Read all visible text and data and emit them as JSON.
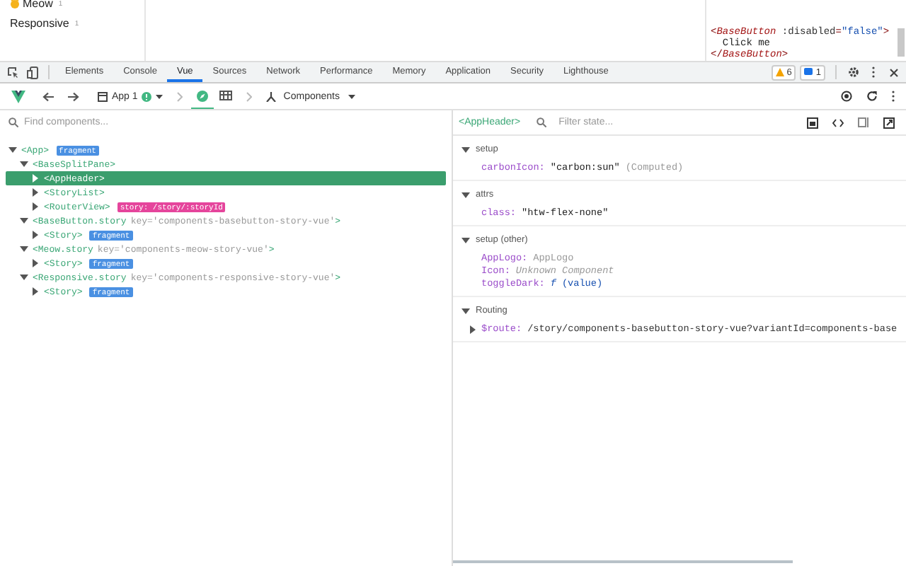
{
  "preview": {
    "stories": [
      {
        "label": "Meow",
        "count": "1",
        "emoji": true
      },
      {
        "label": "Responsive",
        "count": "1",
        "emoji": false
      }
    ],
    "code_lines": [
      [
        {
          "kind": "punct",
          "text": "<"
        },
        {
          "kind": "tag",
          "text": "BaseButton"
        },
        {
          "kind": "attr",
          "text": " :disabled"
        },
        {
          "kind": "punct",
          "text": "="
        },
        {
          "kind": "string",
          "text": "\"false\""
        },
        {
          "kind": "punct",
          "text": ">"
        }
      ],
      [
        {
          "kind": "text",
          "text": "  Click me"
        }
      ],
      [
        {
          "kind": "punct",
          "text": "</"
        },
        {
          "kind": "tag",
          "text": "BaseButton"
        },
        {
          "kind": "punct",
          "text": ">"
        }
      ]
    ]
  },
  "devtools_tabs": [
    {
      "label": "Elements",
      "selected": false
    },
    {
      "label": "Console",
      "selected": false
    },
    {
      "label": "Vue",
      "selected": true
    },
    {
      "label": "Sources",
      "selected": false
    },
    {
      "label": "Network",
      "selected": false
    },
    {
      "label": "Performance",
      "selected": false
    },
    {
      "label": "Memory",
      "selected": false
    },
    {
      "label": "Application",
      "selected": false
    },
    {
      "label": "Security",
      "selected": false
    },
    {
      "label": "Lighthouse",
      "selected": false
    }
  ],
  "warnings": "6",
  "messages": "1",
  "vue_toolbar": {
    "app": "App 1",
    "views": [
      {
        "kind": "components",
        "selected": true
      },
      {
        "kind": "timeline",
        "selected": false
      }
    ],
    "mode": "Components"
  },
  "tree": {
    "placeholder": "Find components...",
    "nodes": [
      {
        "name": "<App>",
        "expanded": true,
        "selected": false,
        "tag": {
          "label": "fragment",
          "color": "#4a90e2"
        },
        "children": [
          {
            "name": "<BaseSplitPane>",
            "expanded": true,
            "selected": false,
            "children": [
              {
                "name": "<AppHeader>",
                "expanded": false,
                "selected": true
              },
              {
                "name": "<StoryList>",
                "expanded": false,
                "selected": false
              },
              {
                "name": "<RouterView>",
                "expanded": false,
                "selected": false,
                "tag": {
                  "label": "story: /story/:storyId",
                  "color": "#e5459c"
                }
              }
            ]
          },
          {
            "name": "<BaseButton.story",
            "key": "key='components-basebutton-story-vue'",
            "close": ">",
            "expanded": true,
            "selected": false,
            "children": [
              {
                "name": "<Story>",
                "expanded": false,
                "selected": false,
                "tag": {
                  "label": "fragment",
                  "color": "#4a90e2"
                }
              }
            ]
          },
          {
            "name": "<Meow.story",
            "key": "key='components-meow-story-vue'",
            "close": ">",
            "expanded": true,
            "selected": false,
            "children": [
              {
                "name": "<Story>",
                "expanded": false,
                "selected": false,
                "tag": {
                  "label": "fragment",
                  "color": "#4a90e2"
                }
              }
            ]
          },
          {
            "name": "<Responsive.story",
            "key": "key='components-responsive-story-vue'",
            "close": ">",
            "expanded": true,
            "selected": false,
            "children": [
              {
                "name": "<Story>",
                "expanded": false,
                "selected": false,
                "tag": {
                  "label": "fragment",
                  "color": "#4a90e2"
                }
              }
            ]
          }
        ]
      }
    ]
  },
  "inspector": {
    "component": "<AppHeader>",
    "placeholder": "Filter state...",
    "sections": [
      {
        "title": "setup",
        "expanded": true,
        "rows": [
          {
            "kind": "string",
            "key": "carbonIcon:",
            "value": "\"carbon:sun\"",
            "note": "(Computed)"
          }
        ]
      },
      {
        "title": "attrs",
        "expanded": true,
        "rows": [
          {
            "kind": "string",
            "key": "class:",
            "value": "\"htw-flex-none\""
          }
        ]
      },
      {
        "title": "setup (other)",
        "expanded": true,
        "rows": [
          {
            "kind": "component",
            "key": "AppLogo:",
            "value": "AppLogo"
          },
          {
            "kind": "unknown",
            "key": "Icon:",
            "value": "Unknown Component"
          },
          {
            "kind": "function",
            "key": "toggleDark:",
            "value": "f",
            "note": "(value)"
          }
        ]
      },
      {
        "title": "Routing",
        "expanded": true,
        "rows": [
          {
            "kind": "object",
            "key": "$route:",
            "value": "/story/components-basebutton-story-vue?variantId=components-base",
            "expanded": false
          }
        ]
      }
    ]
  }
}
